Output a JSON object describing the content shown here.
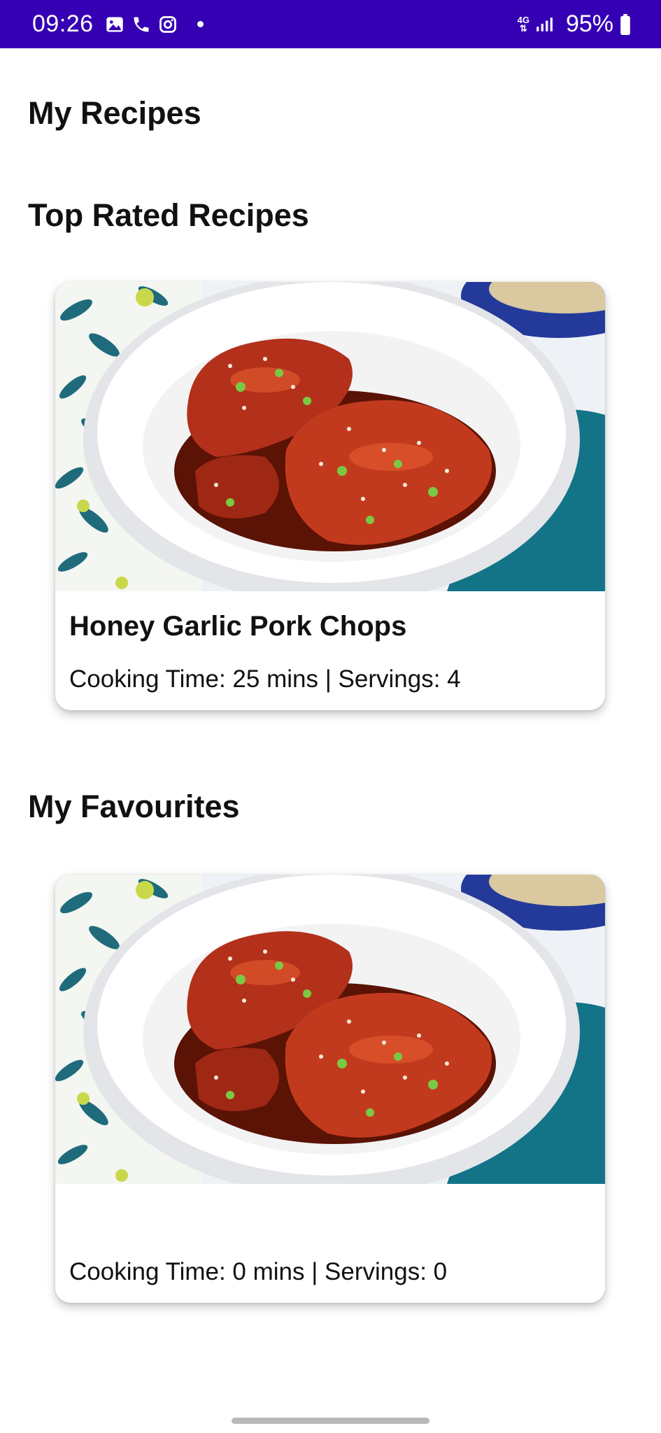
{
  "status_bar": {
    "time": "09:26",
    "network": "4G",
    "battery": "95%",
    "icons": [
      "gallery-icon",
      "phone-icon",
      "instagram-icon",
      "notification-dot-icon",
      "signal-icon",
      "battery-icon"
    ]
  },
  "page": {
    "title": "My Recipes"
  },
  "sections": [
    {
      "title": "Top Rated Recipes",
      "card": {
        "image": "honey-garlic-pork-chops-photo",
        "name": "Honey Garlic Pork Chops",
        "meta": "Cooking Time: 25 mins | Servings: 4"
      }
    },
    {
      "title": "My Favourites",
      "card": {
        "image": "honey-garlic-pork-chops-photo",
        "name": "",
        "meta": "Cooking Time: 0 mins | Servings: 0"
      }
    }
  ],
  "colors": {
    "status_bar": "#3500b3",
    "background": "#ffffff",
    "text": "#111111"
  }
}
